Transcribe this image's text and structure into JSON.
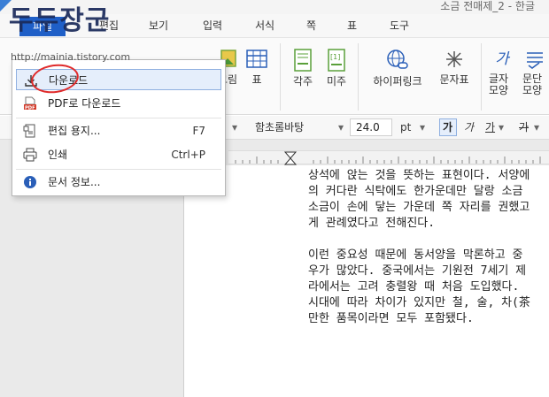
{
  "window": {
    "title": "소금 전매제_2 - 한글"
  },
  "menubar": {
    "file": "파일",
    "tabs": [
      "편집",
      "보기",
      "입력",
      "서식",
      "쪽",
      "표",
      "도구"
    ]
  },
  "ribbon": {
    "buttons": [
      "그림",
      "표",
      "각주",
      "미주",
      "하이퍼링크",
      "문자표",
      "글자 모양",
      "문단 모양"
    ],
    "glyph_ga": "가"
  },
  "formatbar": {
    "font": "함초롬바탕",
    "size": "24.0",
    "unit": "pt",
    "bold": "가",
    "italic": "가",
    "underline": "가",
    "strike": "가"
  },
  "file_menu": {
    "items": [
      {
        "label": "다운로드",
        "shortcut": "",
        "icon": "download-icon"
      },
      {
        "label": "PDF로 다운로드",
        "shortcut": "",
        "icon": "pdf-icon"
      },
      {
        "label": "편집 용지...",
        "shortcut": "F7",
        "icon": "page-setup-icon"
      },
      {
        "label": "인쇄",
        "shortcut": "Ctrl+P",
        "icon": "printer-icon"
      },
      {
        "label": "문서 정보...",
        "shortcut": "",
        "icon": "info-icon"
      }
    ]
  },
  "document": {
    "lines": [
      "상석에 앉는 것을 뜻하는 표현이다. 서양에",
      "의 커다란 식탁에도 한가운데만 달랑 소금",
      "소금이 손에 닿는 가운데 쪽 자리를 권했고",
      "게 관례였다고 전해진다.",
      "",
      "이런 중요성 때문에 동서양을 막론하고 중",
      "우가 많았다. 중국에서는 기원전 7세기 제",
      "라에서는 고려 충렬왕 때 처음 도입했다.",
      "시대에 따라 차이가 있지만 철, 술, 차(茶",
      "만한 품목이라면 모두 포함됐다."
    ]
  },
  "watermark": {
    "logo": "두두장군",
    "url": "http://mainia.tistory.com"
  },
  "colors": {
    "file_menu_bg": "#1f5fc7",
    "highlight": "#e5eefb",
    "annotation": "#e02b2b",
    "pdf": "#d23a2a"
  }
}
